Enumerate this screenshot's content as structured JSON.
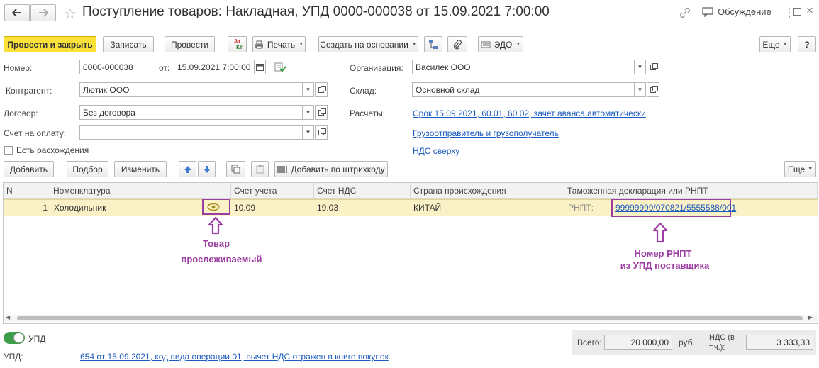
{
  "title": "Поступление товаров: Накладная, УПД 0000-000038 от 15.09.2021 7:00:00",
  "discussion": "Обсуждение",
  "toolbar": {
    "post_close": "Провести и закрыть",
    "save": "Записать",
    "post": "Провести",
    "dtkt": "Ат\nКт",
    "print": "Печать",
    "create_based": "Создать на основании",
    "edo": "ЭДО",
    "more": "Еще",
    "help": "?"
  },
  "form": {
    "number_label": "Номер:",
    "number_value": "0000-000038",
    "date_label": "от:",
    "date_value": "15.09.2021  7:00:00",
    "org_label": "Организация:",
    "org_value": "Василек ООО",
    "contractor_label": "Контрагент:",
    "contractor_value": "Лютик ООО",
    "warehouse_label": "Склад:",
    "warehouse_value": "Основной склад",
    "contract_label": "Договор:",
    "contract_value": "Без договора",
    "settlements_label": "Расчеты:",
    "settlements_link": "Срок 15.09.2021, 60.01, 60.02, зачет аванса автоматически",
    "invoice_label": "Счет на оплату:",
    "invoice_value": "",
    "shipper_link": "Грузоотправитель и грузополучатель",
    "vat_link": "НДС сверху",
    "discrepancy_label": "Есть расхождения"
  },
  "table_toolbar": {
    "add": "Добавить",
    "pick": "Подбор",
    "edit": "Изменить",
    "barcode": "Добавить по штрихкоду",
    "more": "Еще"
  },
  "table": {
    "columns": [
      "N",
      "Номенклатура",
      "Счет учета",
      "Счет НДС",
      "Страна происхождения",
      "Таможенная декларация или РНПТ"
    ],
    "rows": [
      {
        "n": "1",
        "item": "Холодильник",
        "account": "10.09",
        "vat_account": "19.03",
        "country": "КИТАЙ",
        "rnpt_label": "РНПТ:",
        "rnpt": "99999999/070821/5555588/001"
      }
    ]
  },
  "annotations": {
    "tracked_line1": "Товар",
    "tracked_line2": "прослеживаемый",
    "rnpt_line1": "Номер РНПТ",
    "rnpt_line2": "из УПД поставщика"
  },
  "footer": {
    "upd_toggle": "УПД",
    "total_label": "Всего:",
    "total_value": "20 000,00",
    "currency": "руб.",
    "vat_label_1": "НДС (в",
    "vat_label_2": "т.ч.):",
    "vat_value": "3 333,33",
    "upd_label": "УПД:",
    "upd_link": "654 от 15.09.2021, код вида операции 01, вычет НДС отражен в книге покупок"
  },
  "colors": {
    "primary_button": "#fbe23b",
    "highlight_row": "#fbf1c6",
    "annotation": "#9b3ea1",
    "link": "#1c5bbf",
    "toggle_on": "#3c9d4a"
  }
}
